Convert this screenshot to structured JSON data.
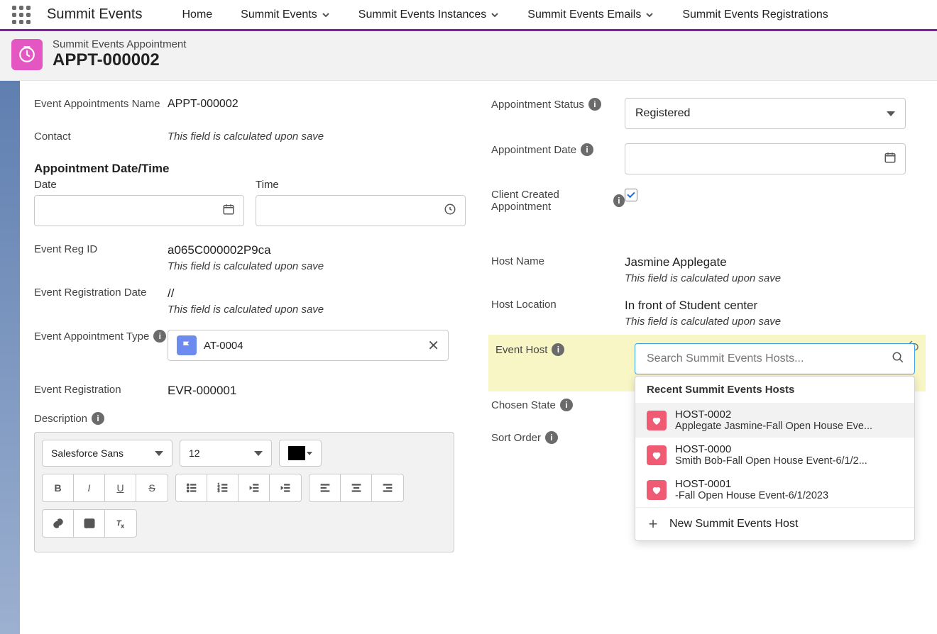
{
  "app_name": "Summit Events",
  "nav": {
    "home": "Home",
    "events": "Summit Events",
    "instances": "Summit Events Instances",
    "emails": "Summit Events Emails",
    "registrations": "Summit Events Registrations"
  },
  "header": {
    "object_label": "Summit Events Appointment",
    "record_name": "APPT-000002"
  },
  "calc_note": "This field is calculated upon save",
  "left": {
    "appt_name_label": "Event Appointments Name",
    "appt_name_value": "APPT-000002",
    "contact_label": "Contact",
    "dt_section": "Appointment Date/Time",
    "date_label": "Date",
    "time_label": "Time",
    "reg_id_label": "Event Reg ID",
    "reg_id_value": "a065C000002P9ca",
    "reg_date_label": "Event Registration Date",
    "reg_date_value": "//",
    "appt_type_label": "Event Appointment Type",
    "appt_type_value": "AT-0004",
    "event_reg_label": "Event Registration",
    "event_reg_value": "EVR-000001",
    "desc_label": "Description",
    "editor": {
      "font": "Salesforce Sans",
      "size": "12"
    }
  },
  "right": {
    "status_label": "Appointment Status",
    "status_value": "Registered",
    "appt_date_label": "Appointment Date",
    "client_created_label": "Client Created Appointment",
    "host_name_label": "Host Name",
    "host_name_value": "Jasmine Applegate",
    "host_loc_label": "Host Location",
    "host_loc_value": "In front of Student center",
    "event_host_label": "Event Host",
    "lookup_placeholder": "Search Summit Events Hosts...",
    "chosen_state_label": "Chosen State",
    "sort_order_label": "Sort Order",
    "dropdown": {
      "recent_header": "Recent Summit Events Hosts",
      "items": [
        {
          "name": "HOST-0002",
          "detail": "Applegate Jasmine-Fall Open House Eve..."
        },
        {
          "name": "HOST-0000",
          "detail": "Smith Bob-Fall Open House Event-6/1/2..."
        },
        {
          "name": "HOST-0001",
          "detail": "-Fall Open House Event-6/1/2023"
        }
      ],
      "new_label": "New Summit Events Host"
    }
  }
}
